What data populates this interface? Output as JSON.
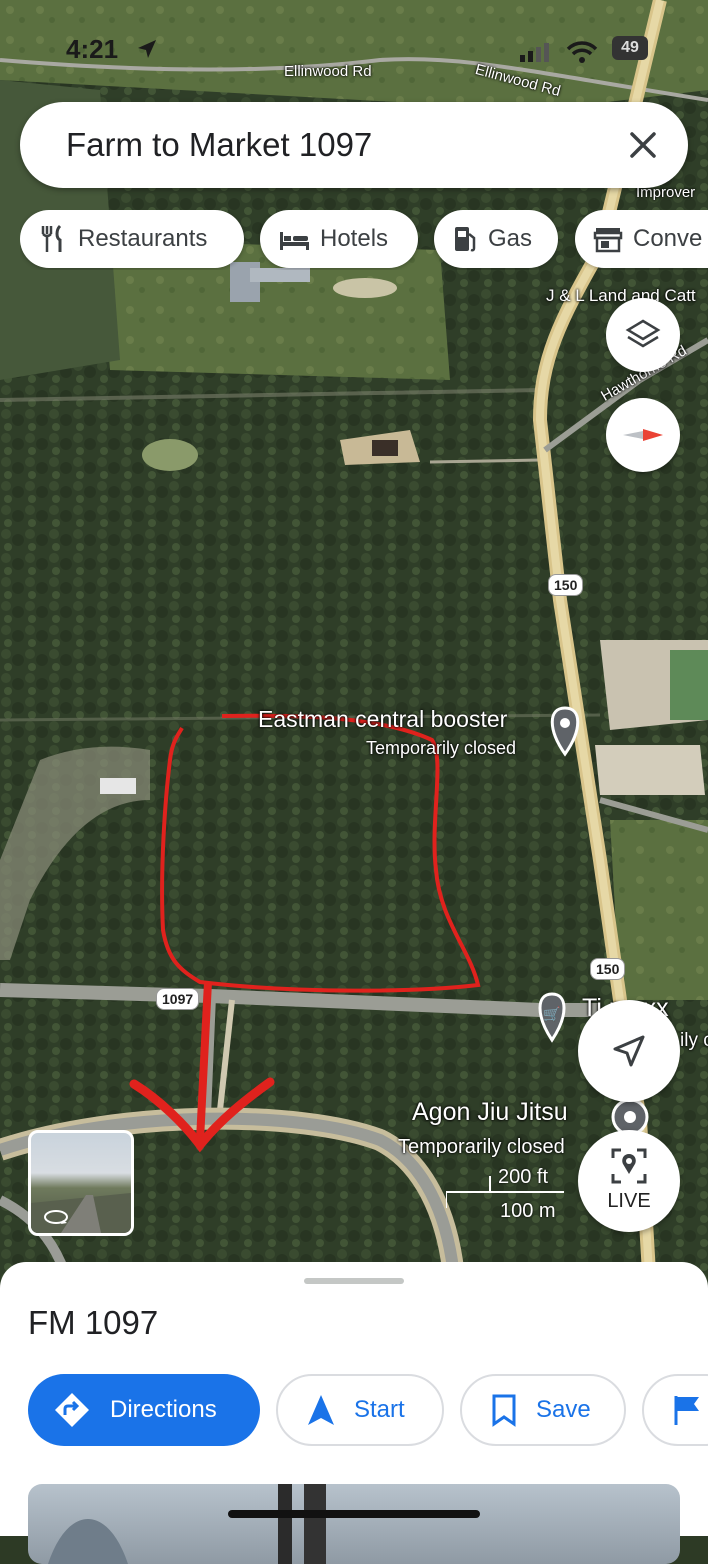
{
  "status_bar": {
    "time": "4:21",
    "battery": "49"
  },
  "search": {
    "query": "Farm to Market 1097"
  },
  "chips": [
    {
      "label": "Restaurants",
      "icon": "fork-knife-icon"
    },
    {
      "label": "Hotels",
      "icon": "bed-icon"
    },
    {
      "label": "Gas",
      "icon": "gas-pump-icon"
    },
    {
      "label": "Conve",
      "icon": "store-icon"
    }
  ],
  "map": {
    "road_labels": [
      "Ellinwood Rd",
      "Ellinwood Rd",
      "Hawthorne Rd",
      "Improver",
      "J & L Land and Catt",
      "Ti    maxx",
      "ily c"
    ],
    "route_shields": [
      "150",
      "150",
      "1097"
    ],
    "poi_eastman": {
      "title": "Eastman central booster",
      "subtitle": "Temporarily closed"
    },
    "poi_agon": {
      "title": "Agon Jiu Jitsu",
      "subtitle": "Temporarily closed"
    },
    "scale": {
      "imperial": "200 ft",
      "metric": "100 m"
    }
  },
  "controls": {
    "live_label": "LIVE"
  },
  "place": {
    "title": "FM 1097",
    "actions": {
      "directions": "Directions",
      "start": "Start",
      "save": "Save"
    }
  },
  "colors": {
    "accent": "#1a73e8",
    "annotation_red": "#e0221d"
  }
}
